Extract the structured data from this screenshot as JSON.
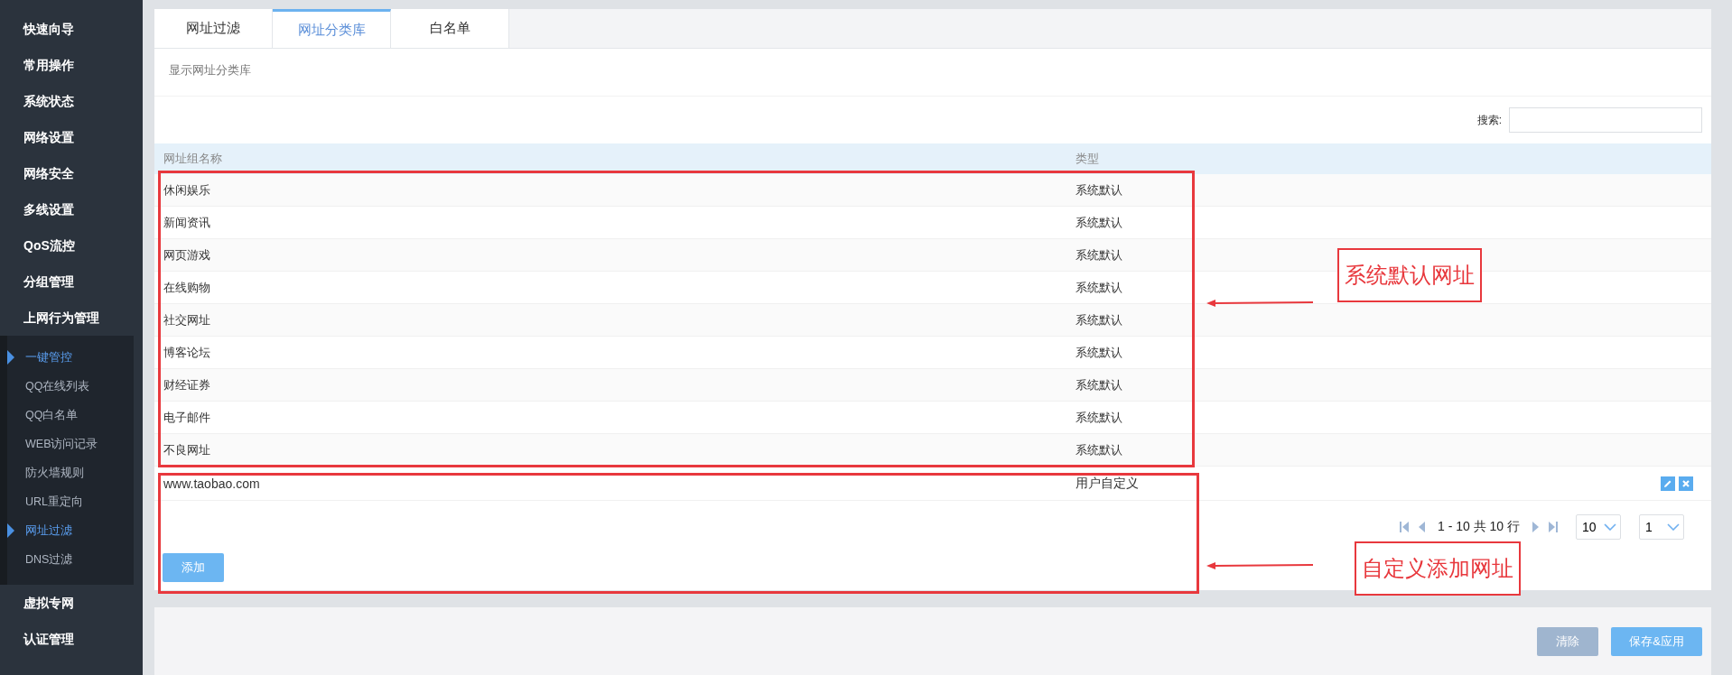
{
  "sidebar": {
    "items": [
      {
        "label": "快速向导"
      },
      {
        "label": "常用操作"
      },
      {
        "label": "系统状态"
      },
      {
        "label": "网络设置"
      },
      {
        "label": "网络安全"
      },
      {
        "label": "多线设置"
      },
      {
        "label": "QoS流控"
      },
      {
        "label": "分组管理"
      },
      {
        "label": "上网行为管理",
        "expanded": true,
        "children": [
          {
            "label": "一键管控",
            "selected": true
          },
          {
            "label": "QQ在线列表",
            "selected": false
          },
          {
            "label": "QQ白名单",
            "selected": false
          },
          {
            "label": "WEB访问记录",
            "selected": false
          },
          {
            "label": "防火墙规则",
            "selected": false
          },
          {
            "label": "URL重定向",
            "selected": false
          },
          {
            "label": "网址过滤",
            "selected": true
          },
          {
            "label": "DNS过滤",
            "selected": false
          }
        ]
      },
      {
        "label": "虚拟专网"
      },
      {
        "label": "认证管理"
      }
    ]
  },
  "tabs": [
    {
      "label": "网址过滤",
      "selected": false
    },
    {
      "label": "网址分类库",
      "selected": true
    },
    {
      "label": "白名单",
      "selected": false
    }
  ],
  "subtitle": "显示网址分类库",
  "search": {
    "label": "搜索:"
  },
  "table": {
    "columns": [
      "网址组名称",
      "类型"
    ],
    "rows": [
      {
        "kind": "default",
        "name": "休闲娱乐",
        "type": "系统默认"
      },
      {
        "kind": "default",
        "name": "新闻资讯",
        "type": "系统默认"
      },
      {
        "kind": "default",
        "name": "网页游戏",
        "type": "系统默认"
      },
      {
        "kind": "default",
        "name": "在线购物",
        "type": "系统默认"
      },
      {
        "kind": "default",
        "name": "社交网址",
        "type": "系统默认"
      },
      {
        "kind": "default",
        "name": "博客论坛",
        "type": "系统默认"
      },
      {
        "kind": "default",
        "name": "财经证券",
        "type": "系统默认"
      },
      {
        "kind": "default",
        "name": "电子邮件",
        "type": "系统默认"
      },
      {
        "kind": "default",
        "name": "不良网址",
        "type": "系统默认"
      },
      {
        "kind": "custom",
        "name": "www.taobao.com",
        "type": "用户自定义"
      }
    ]
  },
  "pagination": {
    "summary": "1 - 10 共 10 行",
    "page_size": "10",
    "page": "1"
  },
  "add_button": "添加",
  "footer_buttons": [
    {
      "label": "清除",
      "disabled": true
    },
    {
      "label": "保存&应用",
      "disabled": false
    }
  ],
  "annotations": [
    {
      "label": "系统默认网址"
    },
    {
      "label": "自定义添加网址"
    }
  ]
}
